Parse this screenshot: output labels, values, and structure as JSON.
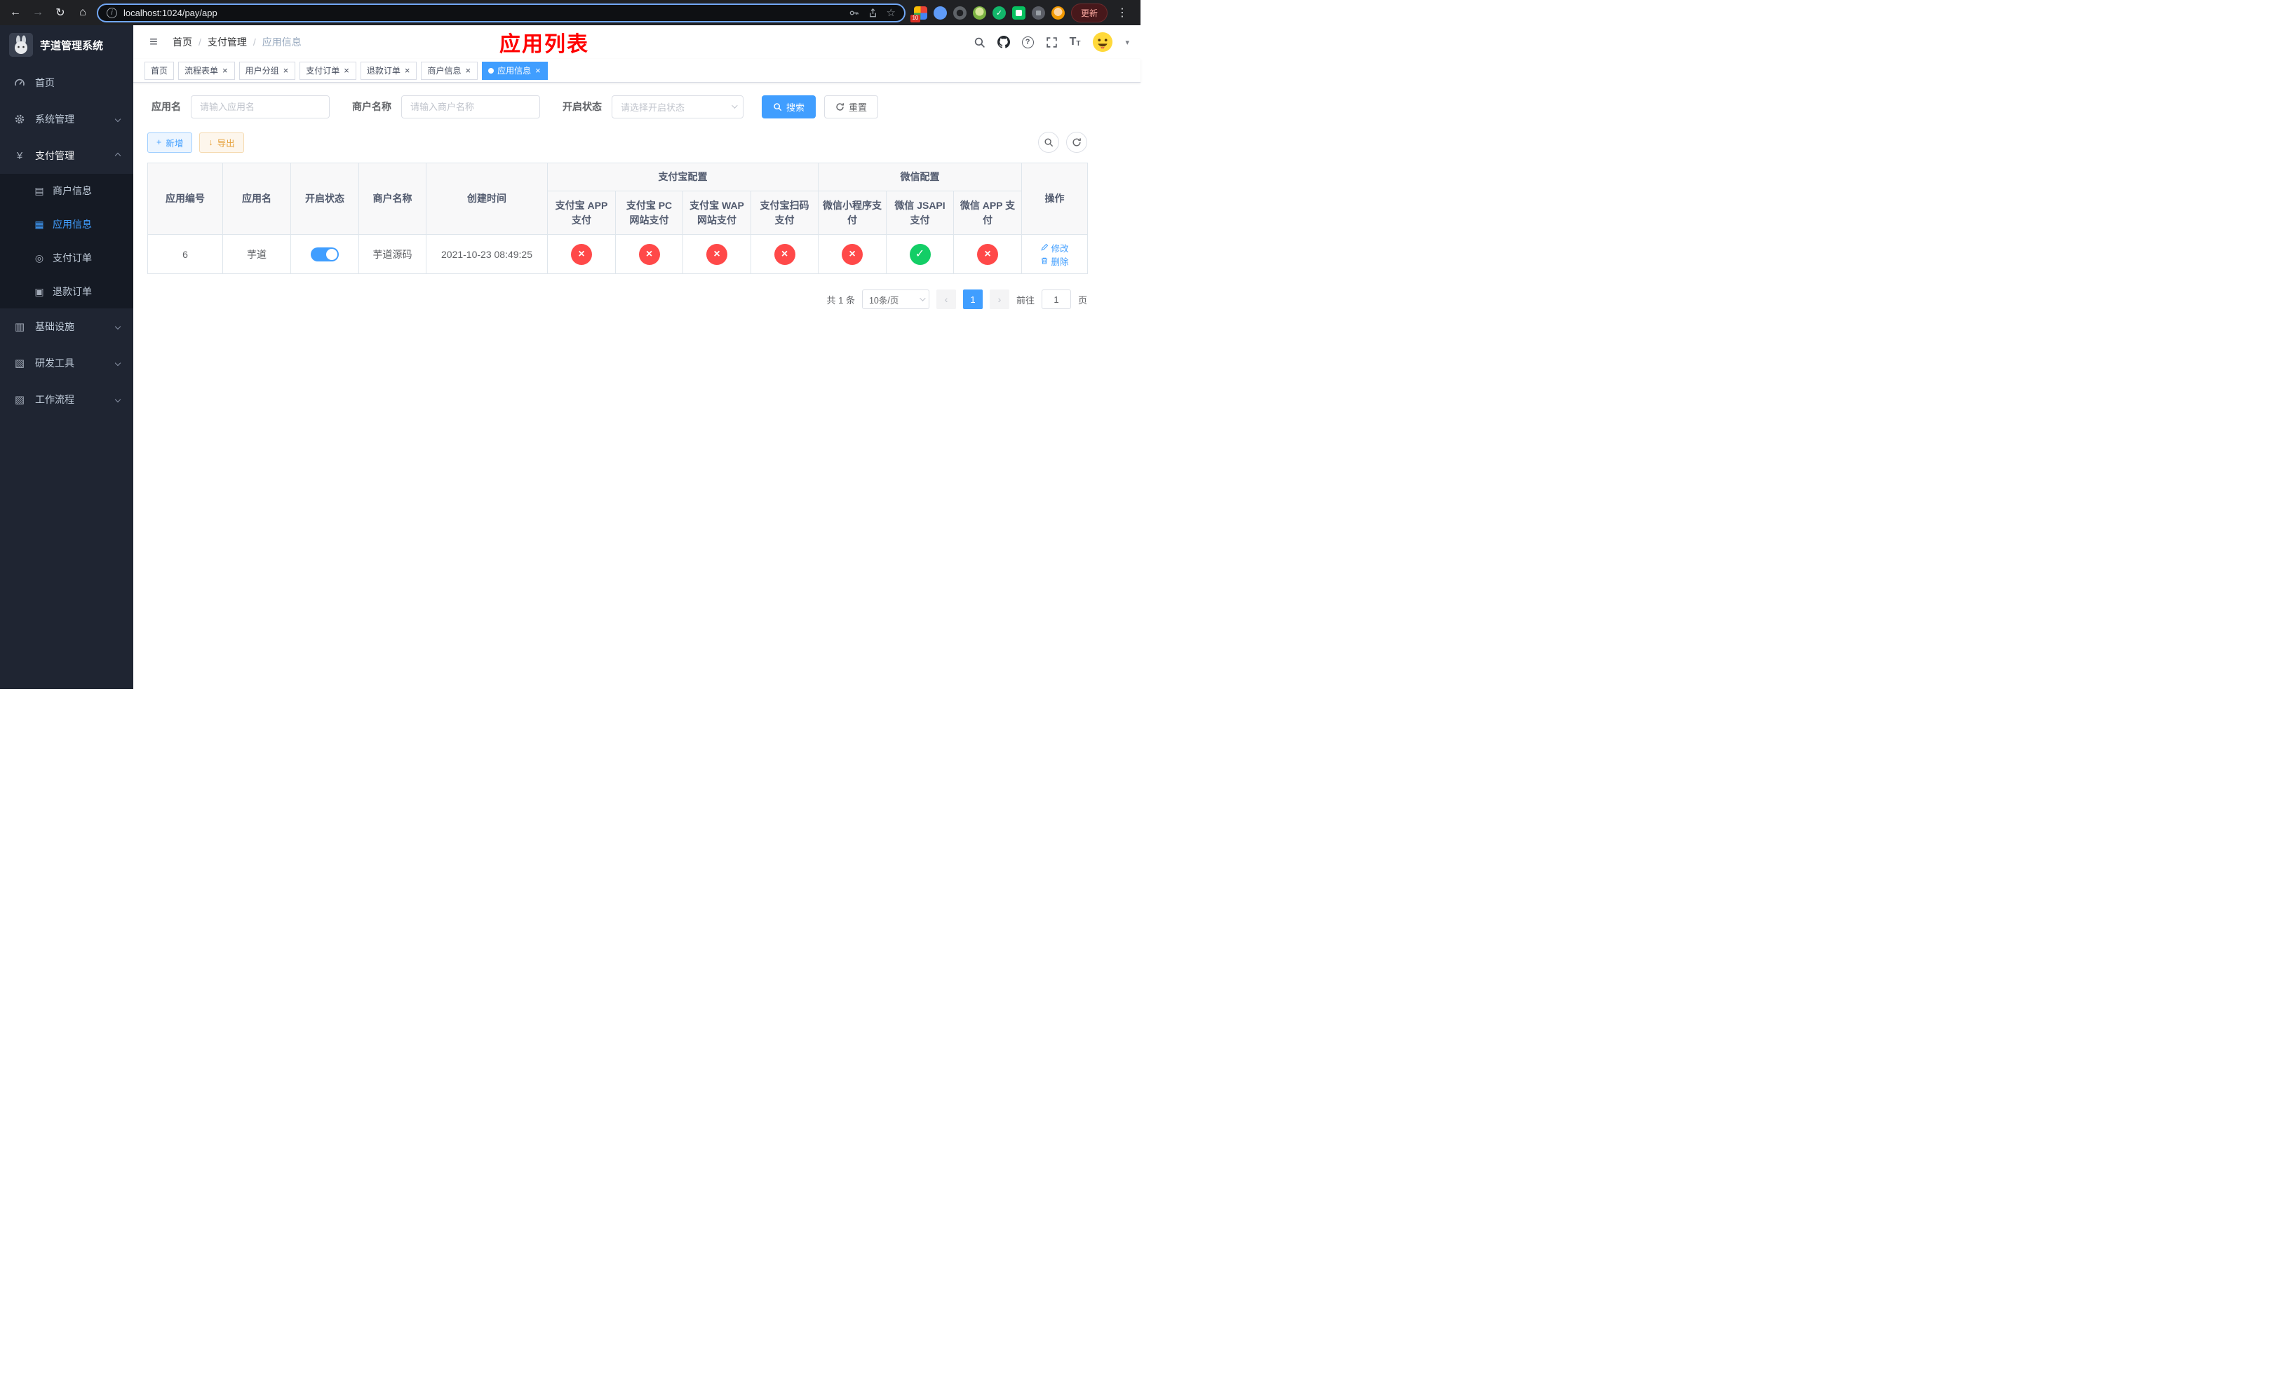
{
  "browser": {
    "url": "localhost:1024/pay/app",
    "update_label": "更新",
    "extension_badge": "10"
  },
  "icons": {
    "back": "←",
    "forward": "→",
    "reload": "↻",
    "home": "⌂",
    "info": "i",
    "star": "☆",
    "dots": "⋮",
    "hamburger": "≡",
    "yen": "¥",
    "merchant": "▤",
    "app": "▦",
    "order": "◎",
    "refund": "▣",
    "infra": "▥",
    "tools": "▧",
    "workflow": "▨",
    "help": "?",
    "caret": "▾",
    "font_large": "T",
    "font_small": "T",
    "plus": "+",
    "download": "↓",
    "close": "×",
    "check": "✓",
    "cross": "×",
    "prev": "‹",
    "next": "›"
  },
  "sidebar": {
    "logo_title": "芋道管理系统",
    "items": [
      {
        "label": "首页",
        "icon": "dashboard-icon"
      },
      {
        "label": "系统管理",
        "icon": "gear-icon"
      },
      {
        "label": "支付管理",
        "icon": "yen-icon",
        "expanded": true,
        "children": [
          {
            "label": "商户信息",
            "icon": "card-icon"
          },
          {
            "label": "应用信息",
            "icon": "grid-icon",
            "active": true
          },
          {
            "label": "支付订单",
            "icon": "order-icon"
          },
          {
            "label": "退款订单",
            "icon": "refund-icon"
          }
        ]
      },
      {
        "label": "基础设施",
        "icon": "infra-icon"
      },
      {
        "label": "研发工具",
        "icon": "tools-icon"
      },
      {
        "label": "工作流程",
        "icon": "workflow-icon"
      }
    ]
  },
  "navbar": {
    "breadcrumb": [
      "首页",
      "支付管理",
      "应用信息"
    ],
    "page_title": "应用列表"
  },
  "tabs": [
    {
      "label": "首页",
      "closable": false,
      "active": false
    },
    {
      "label": "流程表单",
      "closable": true,
      "active": false
    },
    {
      "label": "用户分组",
      "closable": true,
      "active": false
    },
    {
      "label": "支付订单",
      "closable": true,
      "active": false
    },
    {
      "label": "退款订单",
      "closable": true,
      "active": false
    },
    {
      "label": "商户信息",
      "closable": true,
      "active": false
    },
    {
      "label": "应用信息",
      "closable": true,
      "active": true
    }
  ],
  "filters": {
    "app_name": {
      "label": "应用名",
      "placeholder": "请输入应用名",
      "value": ""
    },
    "merchant_name": {
      "label": "商户名称",
      "placeholder": "请输入商户名称",
      "value": ""
    },
    "status": {
      "label": "开启状态",
      "placeholder": "请选择开启状态",
      "value": ""
    },
    "search_label": "搜索",
    "reset_label": "重置"
  },
  "toolbar": {
    "add_label": "新增",
    "export_label": "导出"
  },
  "table": {
    "group_headers": {
      "alipay": "支付宝配置",
      "wechat": "微信配置"
    },
    "columns": [
      "应用编号",
      "应用名",
      "开启状态",
      "商户名称",
      "创建时间",
      "支付宝 APP 支付",
      "支付宝 PC 网站支付",
      "支付宝 WAP 网站支付",
      "支付宝扫码支付",
      "微信小程序支付",
      "微信 JSAPI 支付",
      "微信 APP 支付",
      "操作"
    ],
    "row": {
      "id": "6",
      "name": "芋道",
      "enabled": true,
      "merchant": "芋道源码",
      "created_at": "2021-10-23 08:49:25",
      "configs": [
        false,
        false,
        false,
        false,
        false,
        true,
        false
      ],
      "edit_label": "修改",
      "delete_label": "删除"
    }
  },
  "pagination": {
    "total": "共 1 条",
    "page_size": "10条/页",
    "current_page": "1",
    "goto_prefix": "前往",
    "goto_value": "1",
    "goto_suffix": "页"
  },
  "colors": {
    "accent": "#409eff",
    "success": "#13ce66",
    "danger": "#ff4949",
    "title_red": "#ff0000"
  }
}
